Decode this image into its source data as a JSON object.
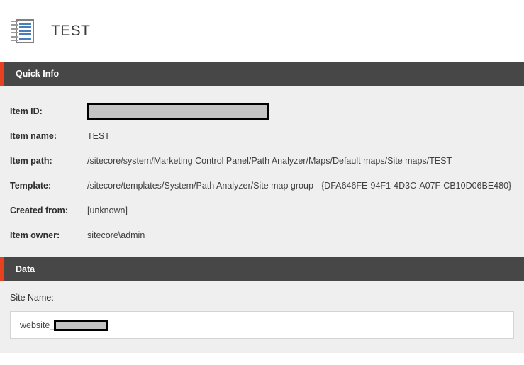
{
  "header": {
    "icon": "document-lines-icon",
    "title": "TEST"
  },
  "quick_info": {
    "section_title": "Quick Info",
    "accent_color": "#e8411f",
    "header_bg": "#474747",
    "rows": [
      {
        "key": "Item ID:",
        "value": "",
        "redacted": true
      },
      {
        "key": "Item name:",
        "value": "TEST",
        "redacted": false
      },
      {
        "key": "Item path:",
        "value": "/sitecore/system/Marketing Control Panel/Path Analyzer/Maps/Default maps/Site maps/TEST",
        "redacted": false
      },
      {
        "key": "Template:",
        "value": "/sitecore/templates/System/Path Analyzer/Site map group - {DFA646FE-94F1-4D3C-A07F-CB10D06BE480}",
        "redacted": false
      },
      {
        "key": "Created from:",
        "value": "[unknown]",
        "redacted": false
      },
      {
        "key": "Item owner:",
        "value": "sitecore\\admin",
        "redacted": false
      }
    ]
  },
  "data_section": {
    "section_title": "Data",
    "site_name_label": "Site Name:",
    "site_name_value": "website_"
  }
}
